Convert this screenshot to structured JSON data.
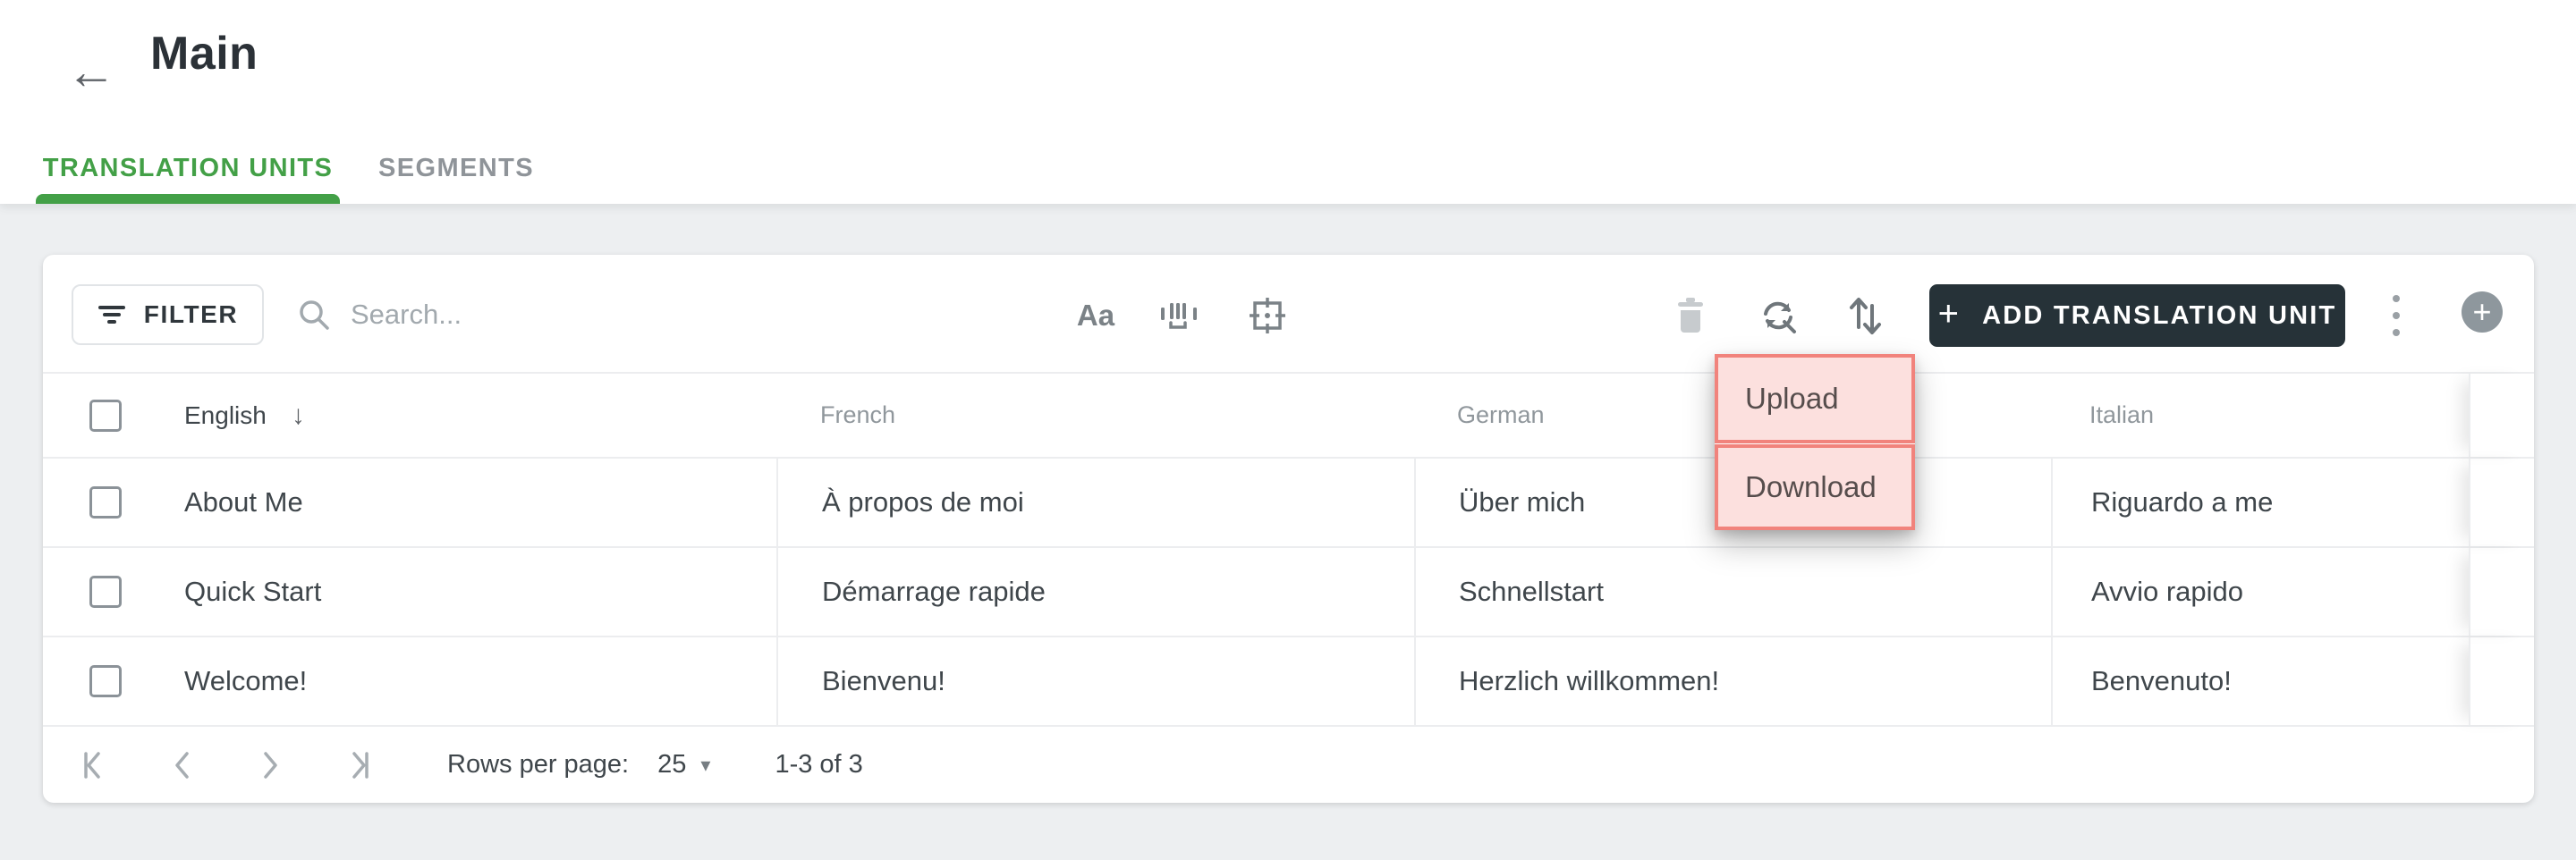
{
  "header": {
    "title": "Main"
  },
  "tabs": {
    "items": [
      {
        "label": "TRANSLATION UNITS",
        "active": true
      },
      {
        "label": "SEGMENTS",
        "active": false
      }
    ]
  },
  "toolbar": {
    "filter_label": "FILTER",
    "search_placeholder": "Search...",
    "match_case_label": "Aa",
    "add_button_label": "ADD TRANSLATION UNIT"
  },
  "menu": {
    "items": [
      {
        "label": "Upload"
      },
      {
        "label": "Download"
      }
    ]
  },
  "table": {
    "columns": [
      {
        "label": "English",
        "sorted": "desc"
      },
      {
        "label": "French"
      },
      {
        "label": "German"
      },
      {
        "label": "Italian"
      }
    ],
    "rows": [
      {
        "english": "About Me",
        "french": "À propos de moi",
        "german": "Über mich",
        "italian": "Riguardo a me"
      },
      {
        "english": "Quick Start",
        "french": "Démarrage rapide",
        "german": "Schnellstart",
        "italian": "Avvio rapido"
      },
      {
        "english": "Welcome!",
        "french": "Bienvenu!",
        "german": "Herzlich willkommen!",
        "italian": "Benvenuto!"
      }
    ]
  },
  "pagination": {
    "rows_per_page_label": "Rows per page:",
    "rows_per_page_value": "25",
    "range_label": "1-3 of 3"
  },
  "icons": {
    "back": "←",
    "sort_desc": "↓",
    "caret_down": "▾",
    "plus": "+"
  },
  "colors": {
    "accent_green": "#43a047",
    "dark_button": "#263238",
    "highlight_fill": "#fce0de",
    "highlight_border": "#f1837c",
    "page_background": "#edeff1"
  }
}
